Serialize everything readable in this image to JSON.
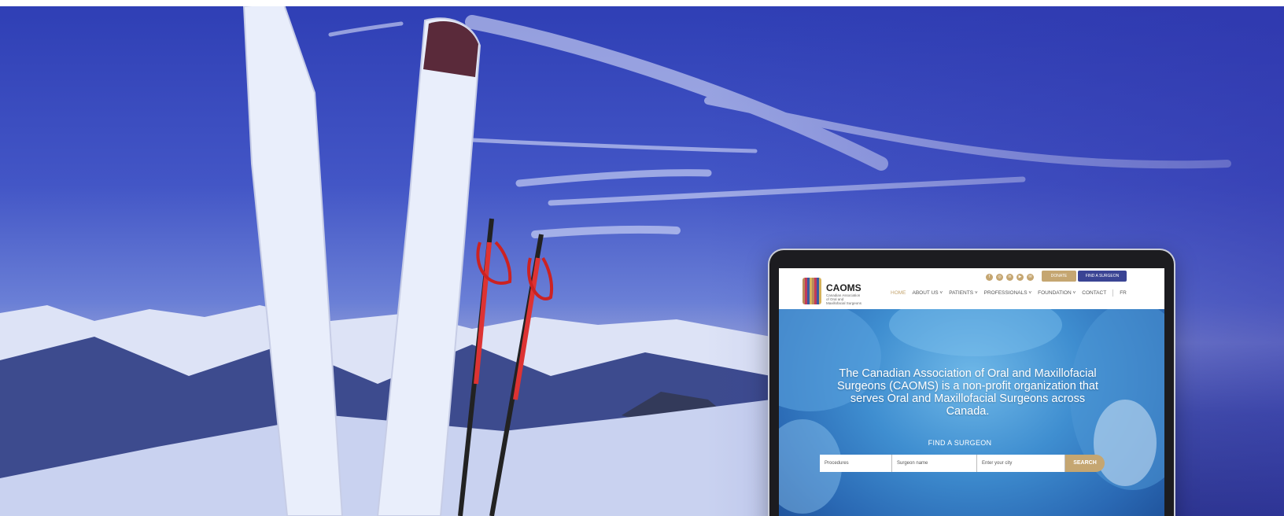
{
  "site": {
    "logo_title": "CAOMS",
    "logo_subtitle": "Canadian Association of Oral and Maxillofacial Surgeons"
  },
  "utility": {
    "donate_label": "DONATE",
    "find_label": "FIND A SURGEON"
  },
  "nav": {
    "items": [
      {
        "label": "HOME",
        "active": true
      },
      {
        "label": "ABOUT US ˅"
      },
      {
        "label": "PATIENTS ˅"
      },
      {
        "label": "PROFESSIONALS ˅"
      },
      {
        "label": "FOUNDATION ˅"
      },
      {
        "label": "CONTACT"
      }
    ],
    "lang": "FR"
  },
  "hero": {
    "caption": "The Canadian Association of Oral and Maxillofacial Surgeons (CAOMS) is a non-profit organization that serves Oral and Maxillofacial Surgeons across Canada."
  },
  "search": {
    "title": "FIND A SURGEON",
    "procedure_value": "Procedures",
    "surgeon_placeholder": "Surgeon name",
    "city_placeholder": "Enter your city",
    "button_label": "SEARCH"
  },
  "colors": {
    "gold": "#c5a671",
    "navy": "#3a4494",
    "sky": "#3f4fc0"
  },
  "icons": [
    "facebook-icon",
    "instagram-icon",
    "linkedin-icon",
    "youtube-icon",
    "email-icon",
    "search-icon",
    "location-icon"
  ]
}
